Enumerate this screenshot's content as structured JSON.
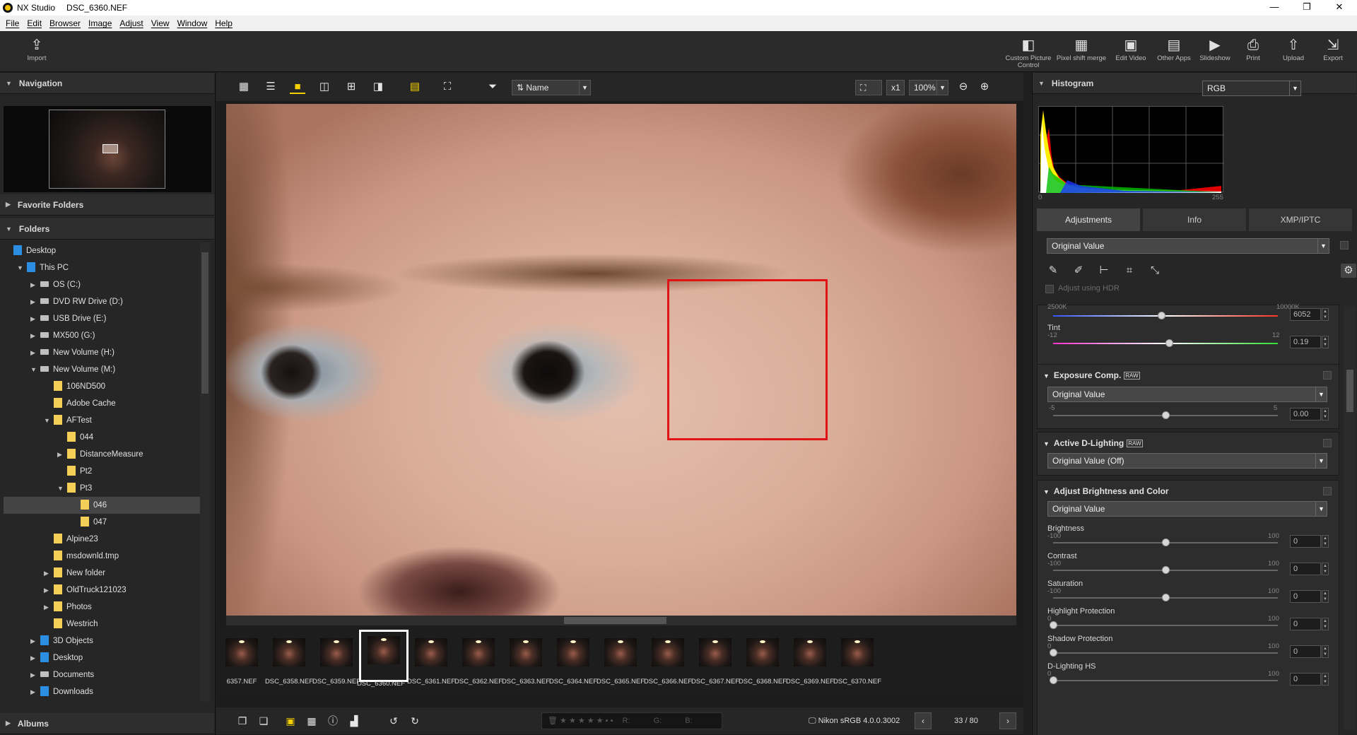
{
  "titlebar": {
    "app": "NX Studio",
    "file": "DSC_6360.NEF",
    "minimize": "—",
    "restore": "❐",
    "close": "✕"
  },
  "menu": [
    "File",
    "Edit",
    "Browser",
    "Image",
    "Adjust",
    "View",
    "Window",
    "Help"
  ],
  "toolbar": {
    "import": "Import",
    "tools": [
      "Custom Picture Control",
      "Pixel shift merge",
      "Edit Video",
      "Other Apps",
      "Slideshow",
      "Print",
      "Upload",
      "Export"
    ]
  },
  "left": {
    "navigation": "Navigation",
    "favorites": "Favorite Folders",
    "folders": "Folders",
    "albums": "Albums",
    "tree": [
      {
        "label": "Desktop",
        "indent": 0,
        "ex": "",
        "icon": "pc"
      },
      {
        "label": "This PC",
        "indent": 1,
        "ex": "▼",
        "icon": "pc"
      },
      {
        "label": "OS (C:)",
        "indent": 2,
        "ex": "▶",
        "icon": "drv"
      },
      {
        "label": "DVD RW Drive (D:)",
        "indent": 2,
        "ex": "▶",
        "icon": "drv"
      },
      {
        "label": "USB Drive (E:)",
        "indent": 2,
        "ex": "▶",
        "icon": "drv"
      },
      {
        "label": "MX500 (G:)",
        "indent": 2,
        "ex": "▶",
        "icon": "drv"
      },
      {
        "label": "New Volume (H:)",
        "indent": 2,
        "ex": "▶",
        "icon": "drv"
      },
      {
        "label": "New Volume (M:)",
        "indent": 2,
        "ex": "▼",
        "icon": "drv"
      },
      {
        "label": "106ND500",
        "indent": 3,
        "ex": "",
        "icon": "fold"
      },
      {
        "label": "Adobe Cache",
        "indent": 3,
        "ex": "",
        "icon": "fold"
      },
      {
        "label": "AFTest",
        "indent": 3,
        "ex": "▼",
        "icon": "fold"
      },
      {
        "label": "044",
        "indent": 4,
        "ex": "",
        "icon": "fold"
      },
      {
        "label": "DistanceMeasure",
        "indent": 4,
        "ex": "▶",
        "icon": "fold"
      },
      {
        "label": "Pt2",
        "indent": 4,
        "ex": "",
        "icon": "fold"
      },
      {
        "label": "Pt3",
        "indent": 4,
        "ex": "▼",
        "icon": "fold"
      },
      {
        "label": "046",
        "indent": 5,
        "ex": "",
        "icon": "fold",
        "selected": true
      },
      {
        "label": "047",
        "indent": 5,
        "ex": "",
        "icon": "fold"
      },
      {
        "label": "Alpine23",
        "indent": 3,
        "ex": "",
        "icon": "fold"
      },
      {
        "label": "msdownld.tmp",
        "indent": 3,
        "ex": "",
        "icon": "fold"
      },
      {
        "label": "New folder",
        "indent": 3,
        "ex": "▶",
        "icon": "fold"
      },
      {
        "label": "OldTruck121023",
        "indent": 3,
        "ex": "▶",
        "icon": "fold"
      },
      {
        "label": "Photos",
        "indent": 3,
        "ex": "▶",
        "icon": "fold"
      },
      {
        "label": "Westrich",
        "indent": 3,
        "ex": "",
        "icon": "fold"
      },
      {
        "label": "3D Objects",
        "indent": 2,
        "ex": "▶",
        "icon": "pc"
      },
      {
        "label": "Desktop",
        "indent": 2,
        "ex": "▶",
        "icon": "pc"
      },
      {
        "label": "Documents",
        "indent": 2,
        "ex": "▶",
        "icon": "drv"
      },
      {
        "label": "Downloads",
        "indent": 2,
        "ex": "▶",
        "icon": "pc"
      }
    ]
  },
  "view": {
    "sort": "Name",
    "zoom_mult": "x1",
    "zoom": "100%"
  },
  "filmstrip": [
    "6357.NEF",
    "DSC_6358.NEF",
    "DSC_6359.NEF",
    "DSC_6360.NEF",
    "DSC_6361.NEF",
    "DSC_6362.NEF",
    "DSC_6363.NEF",
    "DSC_6364.NEF",
    "DSC_6365.NEF",
    "DSC_6366.NEF",
    "DSC_6367.NEF",
    "DSC_6368.NEF",
    "DSC_6369.NEF",
    "DSC_6370.NEF"
  ],
  "current_index": 3,
  "status": {
    "r": "R:",
    "g": "G:",
    "b": "B:",
    "profile": "Nikon sRGB 4.0.0.3002",
    "page": "33 / 80"
  },
  "right": {
    "histogram": "Histogram",
    "channel": "RGB",
    "hist_min": "0",
    "hist_max": "255",
    "tabs": [
      "Adjustments",
      "Info",
      "XMP/IPTC"
    ],
    "preset": "Original Value",
    "hdr": "Adjust using HDR",
    "wb": {
      "min": "2500K",
      "max": "10000K",
      "value": "6052"
    },
    "tint": {
      "label": "Tint",
      "min": "-12",
      "max": "12",
      "value": "0.19"
    },
    "exposure": {
      "title": "Exposure Comp.",
      "badge": "RAW",
      "preset": "Original Value",
      "min": "-5",
      "max": "5",
      "value": "0.00"
    },
    "adl": {
      "title": "Active D-Lighting",
      "badge": "RAW",
      "preset": "Original Value (Off)"
    },
    "abc": {
      "title": "Adjust Brightness and Color",
      "preset": "Original Value",
      "sliders": [
        {
          "label": "Brightness",
          "min": "-100",
          "max": "100",
          "value": "0",
          "pos": 0.5
        },
        {
          "label": "Contrast",
          "min": "-100",
          "max": "100",
          "value": "0",
          "pos": 0.5
        },
        {
          "label": "Saturation",
          "min": "-100",
          "max": "100",
          "value": "0",
          "pos": 0.5
        },
        {
          "label": "Highlight Protection",
          "min": "0",
          "max": "100",
          "value": "0",
          "pos": 0
        },
        {
          "label": "Shadow Protection",
          "min": "0",
          "max": "100",
          "value": "0",
          "pos": 0
        },
        {
          "label": "D-Lighting HS",
          "min": "0",
          "max": "100",
          "value": "0",
          "pos": 0
        }
      ]
    }
  }
}
